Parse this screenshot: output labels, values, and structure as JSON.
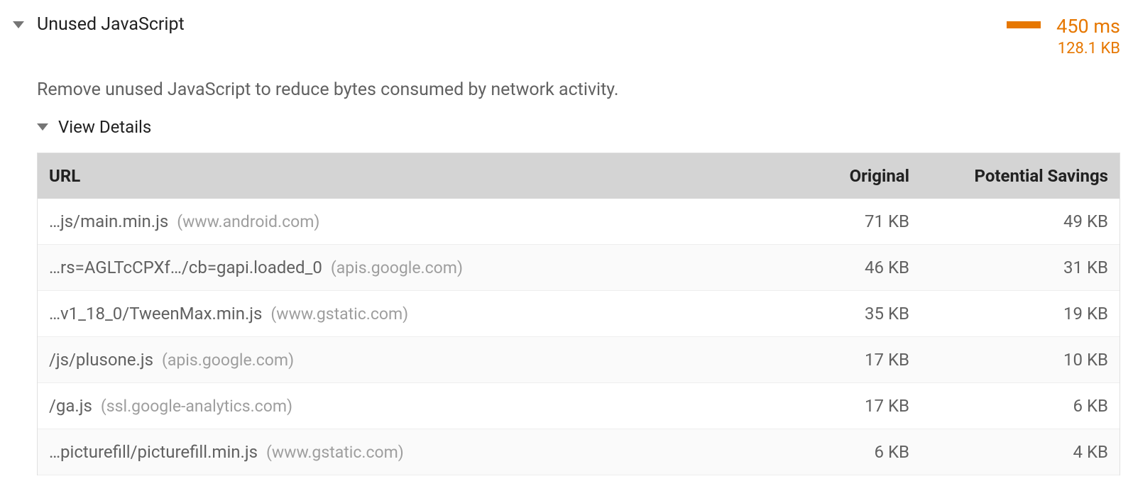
{
  "audit": {
    "title": "Unused JavaScript",
    "description": "Remove unused JavaScript to reduce bytes consumed by network activity.",
    "time": "450 ms",
    "size": "128.1 KB",
    "details_label": "View Details"
  },
  "table": {
    "headers": {
      "url": "URL",
      "original": "Original",
      "savings": "Potential Savings"
    },
    "rows": [
      {
        "path": "…js/main.min.js",
        "domain": "(www.android.com)",
        "original": "71 KB",
        "savings": "49 KB"
      },
      {
        "path": "…rs=AGLTcCPXf…/cb=gapi.loaded_0",
        "domain": "(apis.google.com)",
        "original": "46 KB",
        "savings": "31 KB"
      },
      {
        "path": "…v1_18_0/TweenMax.min.js",
        "domain": "(www.gstatic.com)",
        "original": "35 KB",
        "savings": "19 KB"
      },
      {
        "path": "/js/plusone.js",
        "domain": "(apis.google.com)",
        "original": "17 KB",
        "savings": "10 KB"
      },
      {
        "path": "/ga.js",
        "domain": "(ssl.google-analytics.com)",
        "original": "17 KB",
        "savings": "6 KB"
      },
      {
        "path": "…picturefill/picturefill.min.js",
        "domain": "(www.gstatic.com)",
        "original": "6 KB",
        "savings": "4 KB"
      }
    ]
  }
}
